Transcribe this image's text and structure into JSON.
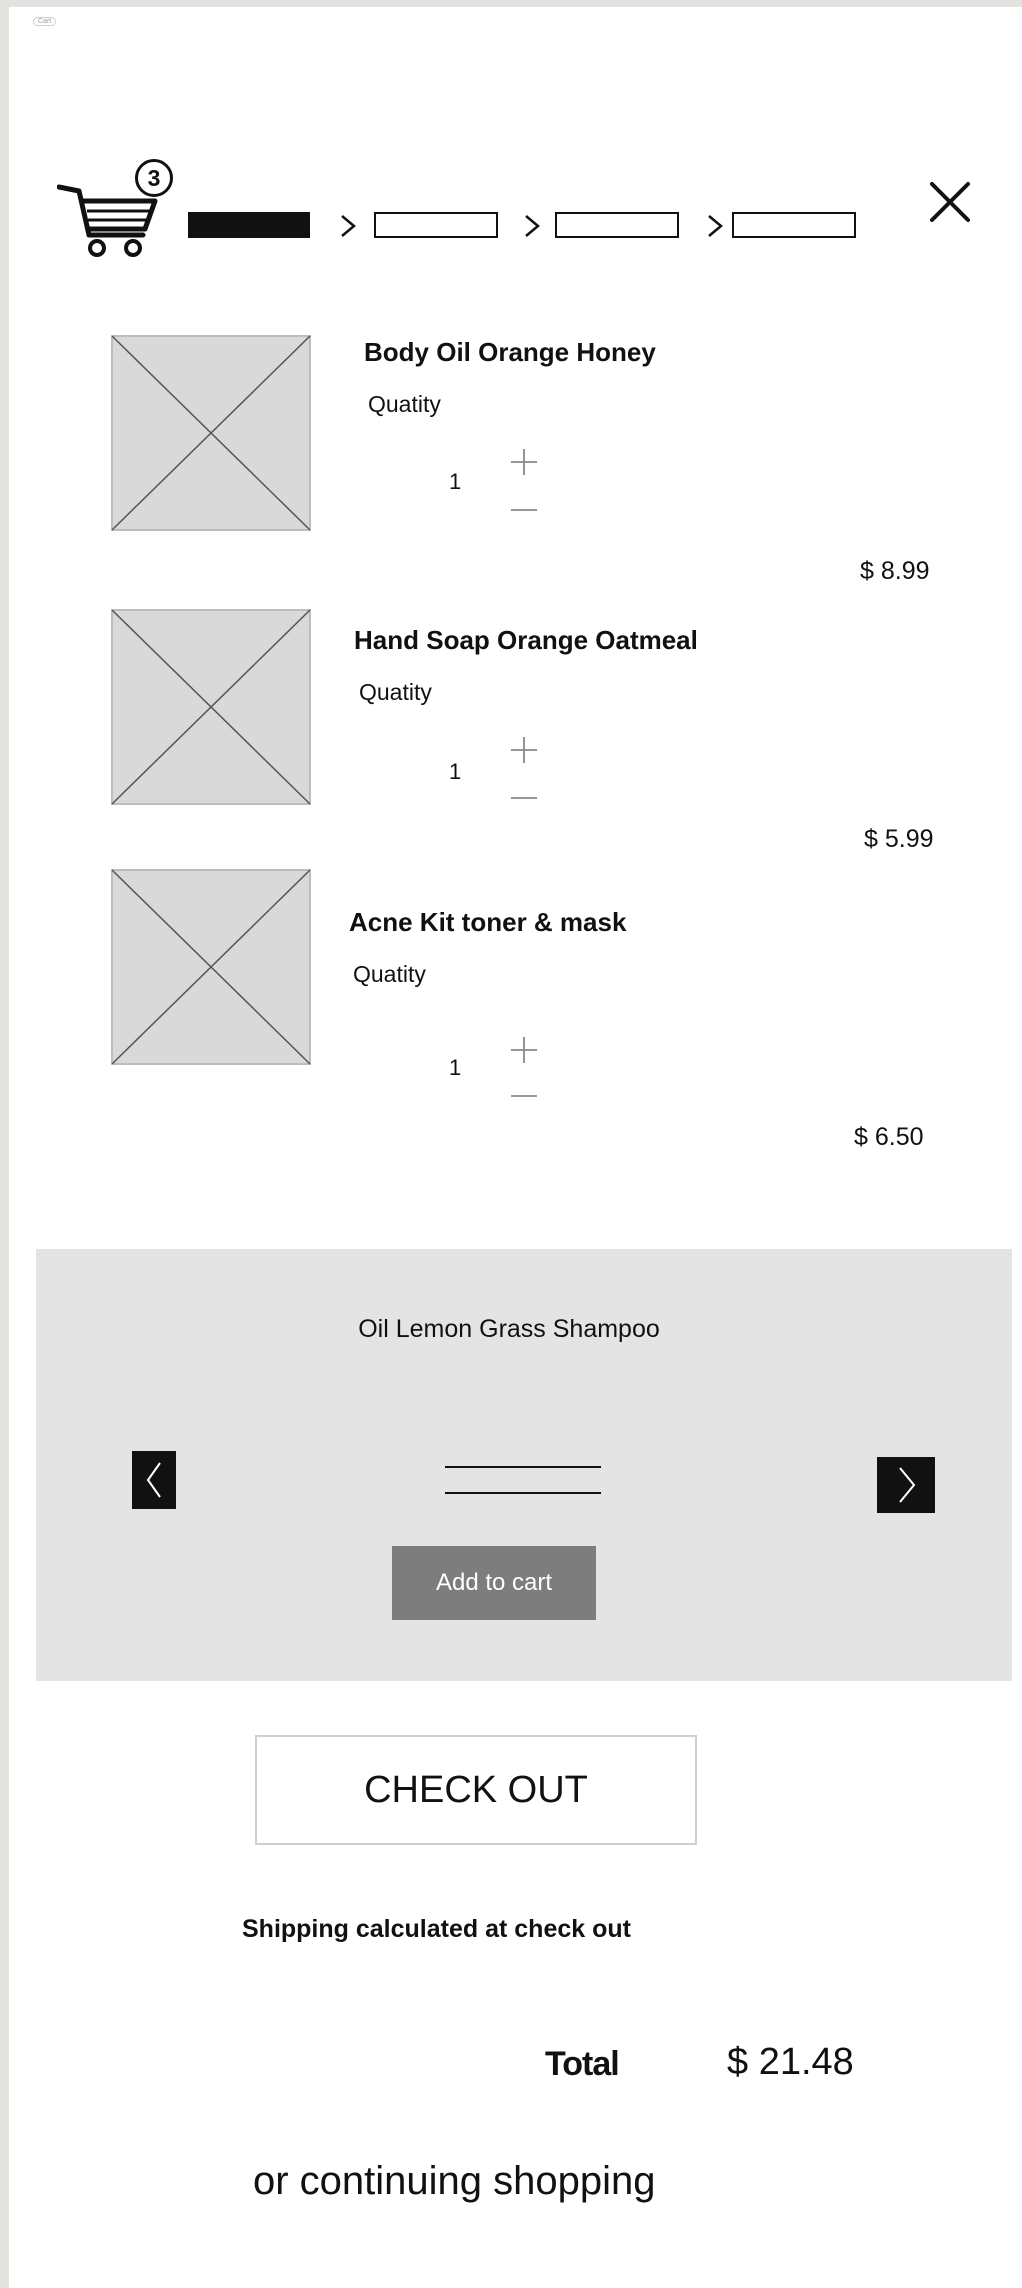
{
  "corner_label": "Cart",
  "cart": {
    "count": "3"
  },
  "steps": [
    "",
    "",
    "",
    ""
  ],
  "items": [
    {
      "name": "Body Oil Orange Honey",
      "qty_label": "Quatity",
      "qty": "1",
      "price": "$ 8.99"
    },
    {
      "name": "Hand Soap Orange Oatmeal",
      "qty_label": "Quatity",
      "qty": "1",
      "price": "$ 5.99"
    },
    {
      "name": "Acne Kit toner & mask",
      "qty_label": "Quatity",
      "qty": "1",
      "price": "$ 6.50"
    }
  ],
  "recommend": {
    "product_name": "Oil Lemon Grass Shampoo",
    "add_label": "Add to cart"
  },
  "checkout": {
    "label": "CHECK OUT"
  },
  "shipping_note": "Shipping calculated at check out",
  "total": {
    "label": "Total",
    "value": "$ 21.48"
  },
  "continue_label": "or continuing shopping",
  "colors": {
    "background": "#e4e2df",
    "panel": "#ffffff",
    "placeholder": "#d9d9d9",
    "recommend_bg": "#e4e4e4",
    "button_gray": "#7d7d7d",
    "ink": "#111111"
  },
  "icons": {
    "cart": "cart-icon",
    "close": "close-icon",
    "step_separator": "chevron-right-icon",
    "prev": "chevron-left-icon",
    "next": "chevron-right-icon",
    "increment": "plus-icon",
    "decrement": "minus-icon"
  }
}
